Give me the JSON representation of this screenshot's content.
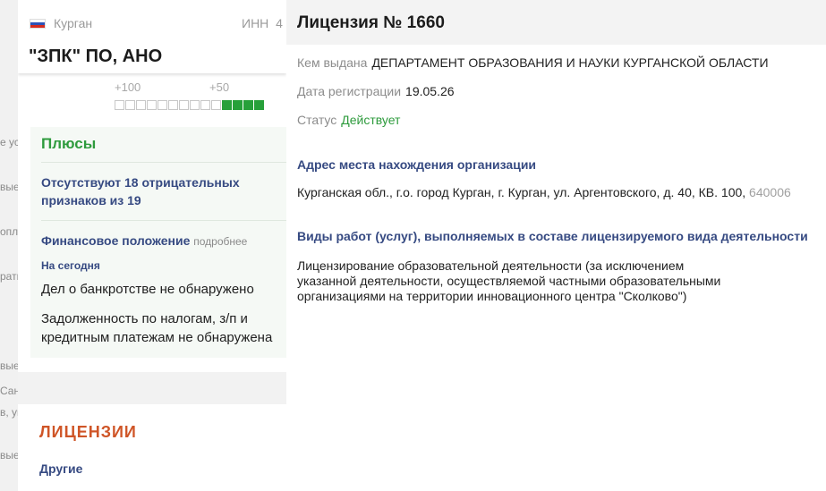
{
  "background_fragments": [
    "е усл",
    "вые",
    "опл",
    "ратв",
    "вые",
    "Сан",
    "в, уп",
    "вые"
  ],
  "company": {
    "region": "Курган",
    "inn_label": "ИНН",
    "inn_value_visible": "4",
    "name": "\"ЗПК\" ПО, АНО",
    "scale_plus100": "+100",
    "scale_plus50": "+50",
    "scale_cells_total": 14,
    "scale_cells_active_from": 10
  },
  "pluses": {
    "title": "Плюсы",
    "absent_line1": "Отсутствуют 18 отрицательных",
    "absent_line2": "признаков из 19",
    "financial_title": "Финансовое положение",
    "financial_more": "подробнее",
    "today_label": "На сегодня",
    "bankrupt_text": "Дел о банкротстве не обнаружено",
    "debt_line1": "Задолженность по налогам, з/п и",
    "debt_line2": "кредитным платежам не обнаружена"
  },
  "licenses": {
    "section_title": "ЛИЦЕНЗИИ",
    "other_label": "Другие"
  },
  "license_panel": {
    "title": "Лицензия № 1660",
    "issued_by_label": "Кем выдана",
    "issued_by_value": "ДЕПАРТАМЕНТ ОБРАЗОВАНИЯ И НАУКИ КУРГАНСКОЙ ОБЛАСТИ",
    "reg_date_label": "Дата регистрации",
    "reg_date_value": "19.05.26",
    "status_label": "Статус",
    "status_value": "Действует",
    "address_title": "Адрес места нахождения организации",
    "address_value": "Курганская обл., г.о. город Курган, г. Курган, ул. Аргентовского, д. 40, КВ. 100,",
    "address_zip": "640006",
    "works_title": "Виды работ (услуг), выполняемых в составе лицензируемого вида деятельности",
    "works_line1": "Лицензирование образовательной деятельности (за исключением",
    "works_line2": "указанной деятельности, осуществляемой частными образовательными",
    "works_line3": "организациями на территории инновационного центра \"Сколково\")"
  },
  "colors": {
    "accent_green": "#2e9b3d",
    "scale_green": "#27a03a",
    "heading_blue": "#364a82",
    "license_orange": "#cf5527"
  }
}
